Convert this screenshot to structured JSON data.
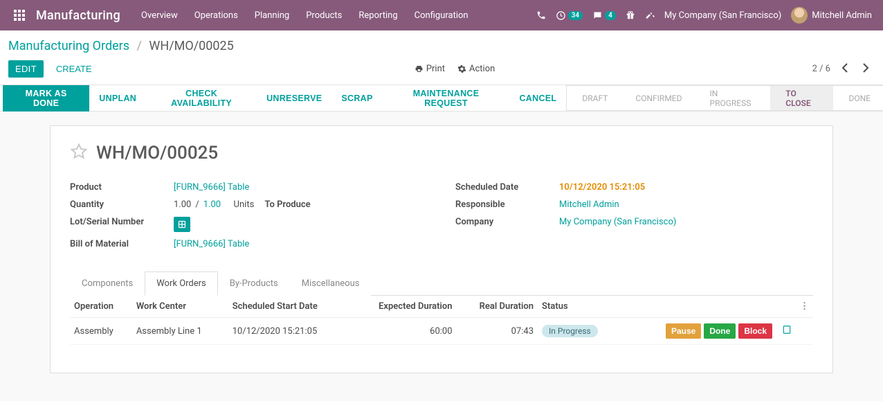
{
  "navbar": {
    "brand": "Manufacturing",
    "menu": [
      "Overview",
      "Operations",
      "Planning",
      "Products",
      "Reporting",
      "Configuration"
    ],
    "activities_badge": "34",
    "messages_badge": "4",
    "company": "My Company (San Francisco)",
    "user": "Mitchell Admin"
  },
  "breadcrumb": {
    "root": "Manufacturing Orders",
    "current": "WH/MO/00025"
  },
  "cp": {
    "edit": "EDIT",
    "create": "CREATE",
    "print": "Print",
    "action": "Action",
    "pager": "2 / 6"
  },
  "statusbar": {
    "buttons": [
      "MARK AS DONE",
      "UNPLAN",
      "CHECK AVAILABILITY",
      "UNRESERVE",
      "SCRAP",
      "MAINTENANCE REQUEST",
      "CANCEL"
    ],
    "steps": [
      "DRAFT",
      "CONFIRMED",
      "IN PROGRESS",
      "TO CLOSE",
      "DONE"
    ],
    "current_step": "TO CLOSE"
  },
  "record": {
    "title": "WH/MO/00025",
    "fields": {
      "product_label": "Product",
      "product_value": "[FURN_9666] Table",
      "quantity_label": "Quantity",
      "quantity_done": "1.00",
      "quantity_total": "1.00",
      "quantity_uom": "Units",
      "quantity_suffix": "To Produce",
      "lot_label": "Lot/Serial Number",
      "bom_label": "Bill of Material",
      "bom_value": "[FURN_9666] Table",
      "scheduled_label": "Scheduled Date",
      "scheduled_value": "10/12/2020 15:21:05",
      "responsible_label": "Responsible",
      "responsible_value": "Mitchell Admin",
      "company_label": "Company",
      "company_value": "My Company (San Francisco)"
    }
  },
  "tabs": [
    "Components",
    "Work Orders",
    "By-Products",
    "Miscellaneous"
  ],
  "active_tab": "Work Orders",
  "work_orders": {
    "headers": {
      "operation": "Operation",
      "work_center": "Work Center",
      "scheduled": "Scheduled Start Date",
      "expected": "Expected Duration",
      "real": "Real Duration",
      "status": "Status"
    },
    "row": {
      "operation": "Assembly",
      "work_center": "Assembly Line 1",
      "scheduled": "10/12/2020 15:21:05",
      "expected": "60:00",
      "real": "07:43",
      "status": "In Progress",
      "btn_pause": "Pause",
      "btn_done": "Done",
      "btn_block": "Block"
    }
  }
}
